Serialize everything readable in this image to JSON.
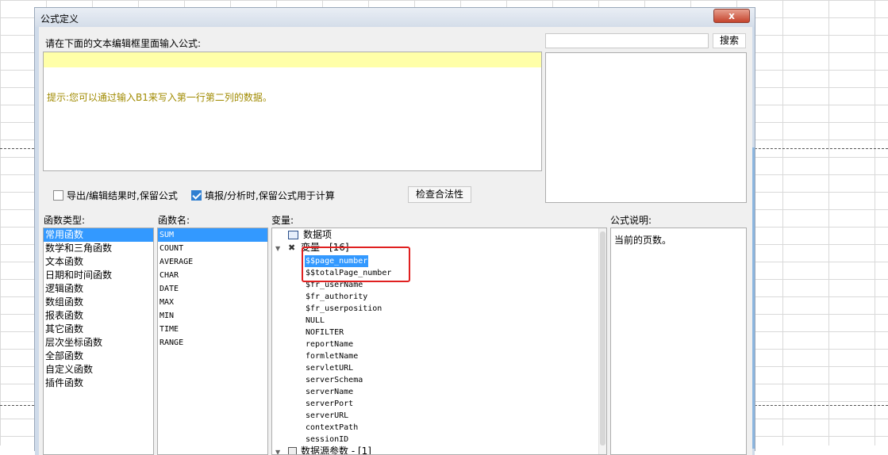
{
  "dialog": {
    "title": "公式定义",
    "close_label": "x",
    "prompt": "请在下面的文本编辑框里面输入公式:",
    "editor_value": "",
    "hint": "提示:您可以通过输入B1来写入第一行第二列的数据。",
    "search": {
      "value": "",
      "button_label": "搜索"
    },
    "options": {
      "keep_formula_on_export": {
        "label": "导出/编辑结果时,保留公式",
        "checked": false
      },
      "keep_formula_on_fill": {
        "label": "填报/分析时,保留公式用于计算",
        "checked": true
      }
    },
    "validate_button_label": "检查合法性"
  },
  "columns": {
    "function_type_label": "函数类型:",
    "function_name_label": "函数名:",
    "variable_label": "变量:",
    "description_label": "公式说明:"
  },
  "function_types": [
    "常用函数",
    "数学和三角函数",
    "文本函数",
    "日期和时间函数",
    "逻辑函数",
    "数组函数",
    "报表函数",
    "其它函数",
    "层次坐标函数",
    "全部函数",
    "自定义函数",
    "插件函数"
  ],
  "function_types_selected": "常用函数",
  "function_names": [
    "SUM",
    "COUNT",
    "AVERAGE",
    "CHAR",
    "DATE",
    "MAX",
    "MIN",
    "TIME",
    "RANGE"
  ],
  "function_names_selected": "SUM",
  "variables": {
    "data_item_label": "数据项",
    "variable_group_label": "变量 - [16]",
    "items": [
      "$$page_number",
      "$$totalPage_number",
      "$fr_userName",
      "$fr_authority",
      "$fr_userposition",
      "NULL",
      "NOFILTER",
      "reportName",
      "formletName",
      "servletURL",
      "serverSchema",
      "serverName",
      "serverPort",
      "serverURL",
      "contextPath",
      "sessionID"
    ],
    "selected": "$$page_number",
    "datasource_group_label": "数据源参数 - [1]"
  },
  "description_text": "当前的页数。",
  "colors": {
    "selection": "#3399ff",
    "highlight_box": "#e02020",
    "hint_text": "#a08a00",
    "editor_line": "#ffffa8"
  }
}
